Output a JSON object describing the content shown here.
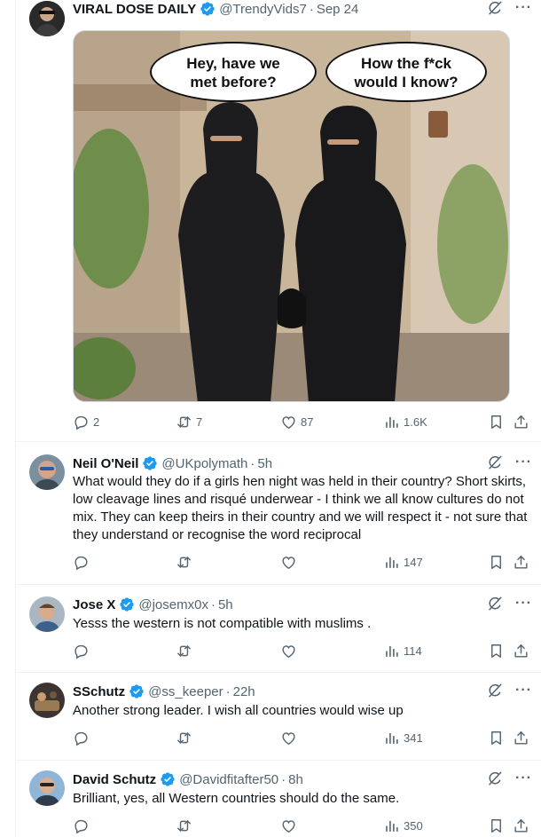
{
  "colors": {
    "accent": "#1d9bf0",
    "muted": "#536471",
    "text": "#0f1419",
    "divider": "#eff3f4"
  },
  "icons": [
    "verified-badge-icon",
    "grok-icon",
    "more-icon",
    "reply-icon",
    "retweet-icon",
    "like-icon",
    "views-icon",
    "bookmark-icon",
    "share-icon"
  ],
  "main_tweet": {
    "name": "VIRAL DOSE DAILY",
    "handle": "@TrendyVids7",
    "time": "Sep 24",
    "image": {
      "bubble_left": "Hey, have we met before?",
      "bubble_right": "How the f*ck would I know?"
    },
    "replies": "2",
    "retweets": "7",
    "likes": "87",
    "views": "1.6K"
  },
  "replies": [
    {
      "name": "Neil O'Neil",
      "handle": "@UKpolymath",
      "time": "5h",
      "text": "What would they do if a girls hen night was held in their country? Short skirts, low cleavage lines and risqué underwear - I think we all know cultures do not mix. They can keep theirs in their country and we will respect it - not sure that they understand or recognise the word reciprocal",
      "views": "147"
    },
    {
      "name": "Jose X",
      "handle": "@josemx0x",
      "time": "5h",
      "text": "Yesss the western is not compatible with muslims .",
      "views": "114"
    },
    {
      "name": "SSchutz",
      "handle": "@ss_keeper",
      "time": "22h",
      "text": "Another strong leader. I wish all countries would wise up",
      "views": "341"
    },
    {
      "name": "David Schutz",
      "handle": "@Davidfitafter50",
      "time": "8h",
      "text": "Brilliant, yes, all Western countries should do the same.",
      "views": "350"
    }
  ]
}
